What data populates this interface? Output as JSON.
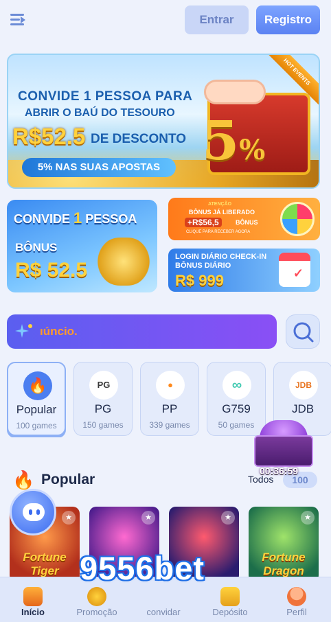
{
  "header": {
    "login_label": "Entrar",
    "register_label": "Registro"
  },
  "banner_main": {
    "line1": "CONVIDE 1 PESSOA PARA",
    "line2": "ABRIR O BAÚ DO TESOURO",
    "amount": "R$52.5",
    "line3": "DE DESCONTO",
    "pill": "5% NAS SUAS APOSTAS",
    "percent": "5",
    "ribbon": "HOT EVENTS"
  },
  "banner_left": {
    "title_a": "CONVIDE",
    "title_one": "1",
    "title_b": "PESSOA",
    "bonus": "BÔNUS",
    "amount": "R$ 52.5"
  },
  "banner_right_top": {
    "attention": "ATENÇÃO",
    "line1": "BÔNUS JÁ LIBERADO",
    "amount": "+R$56,5",
    "bonus": "BÔNUS",
    "cta": "CLIQUE PARA RECEBER AGORA"
  },
  "banner_right_bottom": {
    "line1": "LOGIN DIÁRIO CHECK-IN",
    "line2": "BÔNUS DIÁRIO",
    "amount": "R$ 999"
  },
  "search": {
    "marquee_text": "ıúncio."
  },
  "providers": [
    {
      "name": "Popular",
      "count": "100 games",
      "icon": "flame-icon",
      "glyph": "🔥"
    },
    {
      "name": "PG",
      "count": "150 games",
      "icon": "pg-logo-icon",
      "glyph": "PG"
    },
    {
      "name": "PP",
      "count": "339 games",
      "icon": "pp-logo-icon",
      "glyph": "●"
    },
    {
      "name": "G759",
      "count": "50 games",
      "icon": "g759-logo-icon",
      "glyph": "∞"
    },
    {
      "name": "JDB",
      "count": "",
      "icon": "jdb-logo-icon",
      "glyph": "JDB"
    }
  ],
  "popular": {
    "title": "Popular",
    "todos_label": "Todos",
    "todos_count": "100"
  },
  "treasure_timer": "00:36:59",
  "games": [
    {
      "title": "Fortune Tiger"
    },
    {
      "title": ""
    },
    {
      "title": ""
    },
    {
      "title": "Fortune Dragon"
    }
  ],
  "brand": "9556bet",
  "bottom_nav": [
    {
      "label": "Início",
      "icon": "slot-machine-icon"
    },
    {
      "label": "Promoção",
      "icon": "medal-icon"
    },
    {
      "label": "convidar",
      "icon": "invite-icon"
    },
    {
      "label": "Depósito",
      "icon": "wallet-icon"
    },
    {
      "label": "Perfil",
      "icon": "profile-icon"
    }
  ],
  "colors": {
    "accent": "#5b82f2",
    "search_gradient_start": "#5a5ff0",
    "search_gradient_end": "#8a4ff5",
    "gold": "#ffd23d"
  }
}
